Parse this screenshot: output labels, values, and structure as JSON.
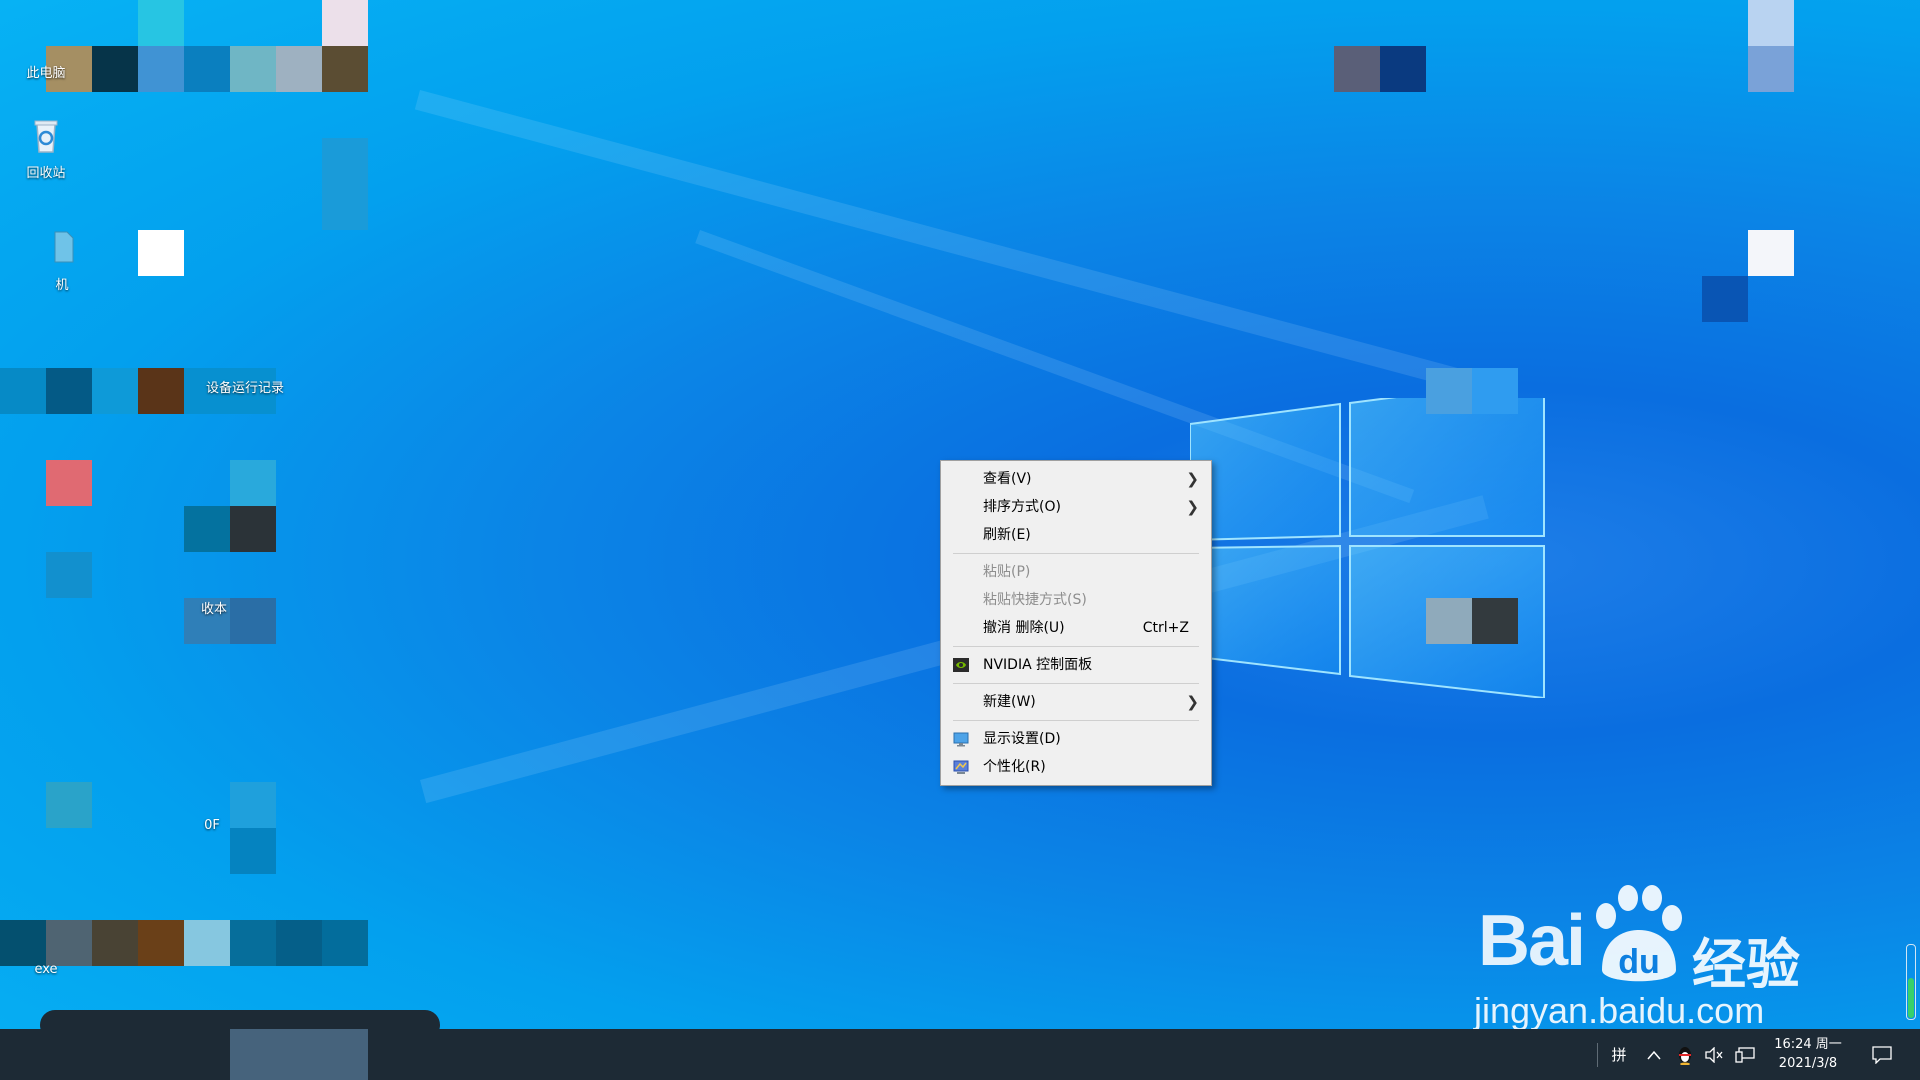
{
  "desktop": {
    "icons": [
      {
        "label": "此电脑"
      },
      {
        "label": "回收站"
      },
      {
        "label": "机"
      },
      {
        "label": "设备运行记录"
      },
      {
        "label": "收本"
      },
      {
        "label": "0F"
      },
      {
        "label": "exe"
      }
    ]
  },
  "context_menu": {
    "items": [
      {
        "label": "查看(V)",
        "has_submenu": true,
        "enabled": true
      },
      {
        "label": "排序方式(O)",
        "has_submenu": true,
        "enabled": true
      },
      {
        "label": "刷新(E)",
        "has_submenu": false,
        "enabled": true
      },
      {
        "label": "粘贴(P)",
        "has_submenu": false,
        "enabled": false
      },
      {
        "label": "粘贴快捷方式(S)",
        "has_submenu": false,
        "enabled": false
      },
      {
        "label": "撤消 删除(U)",
        "shortcut": "Ctrl+Z",
        "enabled": true
      },
      {
        "label": "NVIDIA 控制面板",
        "icon": "nvidia-icon",
        "enabled": true
      },
      {
        "label": "新建(W)",
        "has_submenu": true,
        "enabled": true
      },
      {
        "label": "显示设置(D)",
        "icon": "display-settings-icon",
        "enabled": true
      },
      {
        "label": "个性化(R)",
        "icon": "personalize-icon",
        "enabled": true
      }
    ]
  },
  "taskbar": {
    "ime_label": "拼",
    "tray_icons": [
      "chevron-up-icon",
      "qq-penguin-icon",
      "volume-muted-icon",
      "network-icon"
    ],
    "clock_time": "16:24 周一",
    "clock_date": "2021/3/8"
  },
  "watermark": {
    "brand": "Bai",
    "brand_du": "du",
    "brand_cn": "经验",
    "url": "jingyan.baidu.com"
  }
}
